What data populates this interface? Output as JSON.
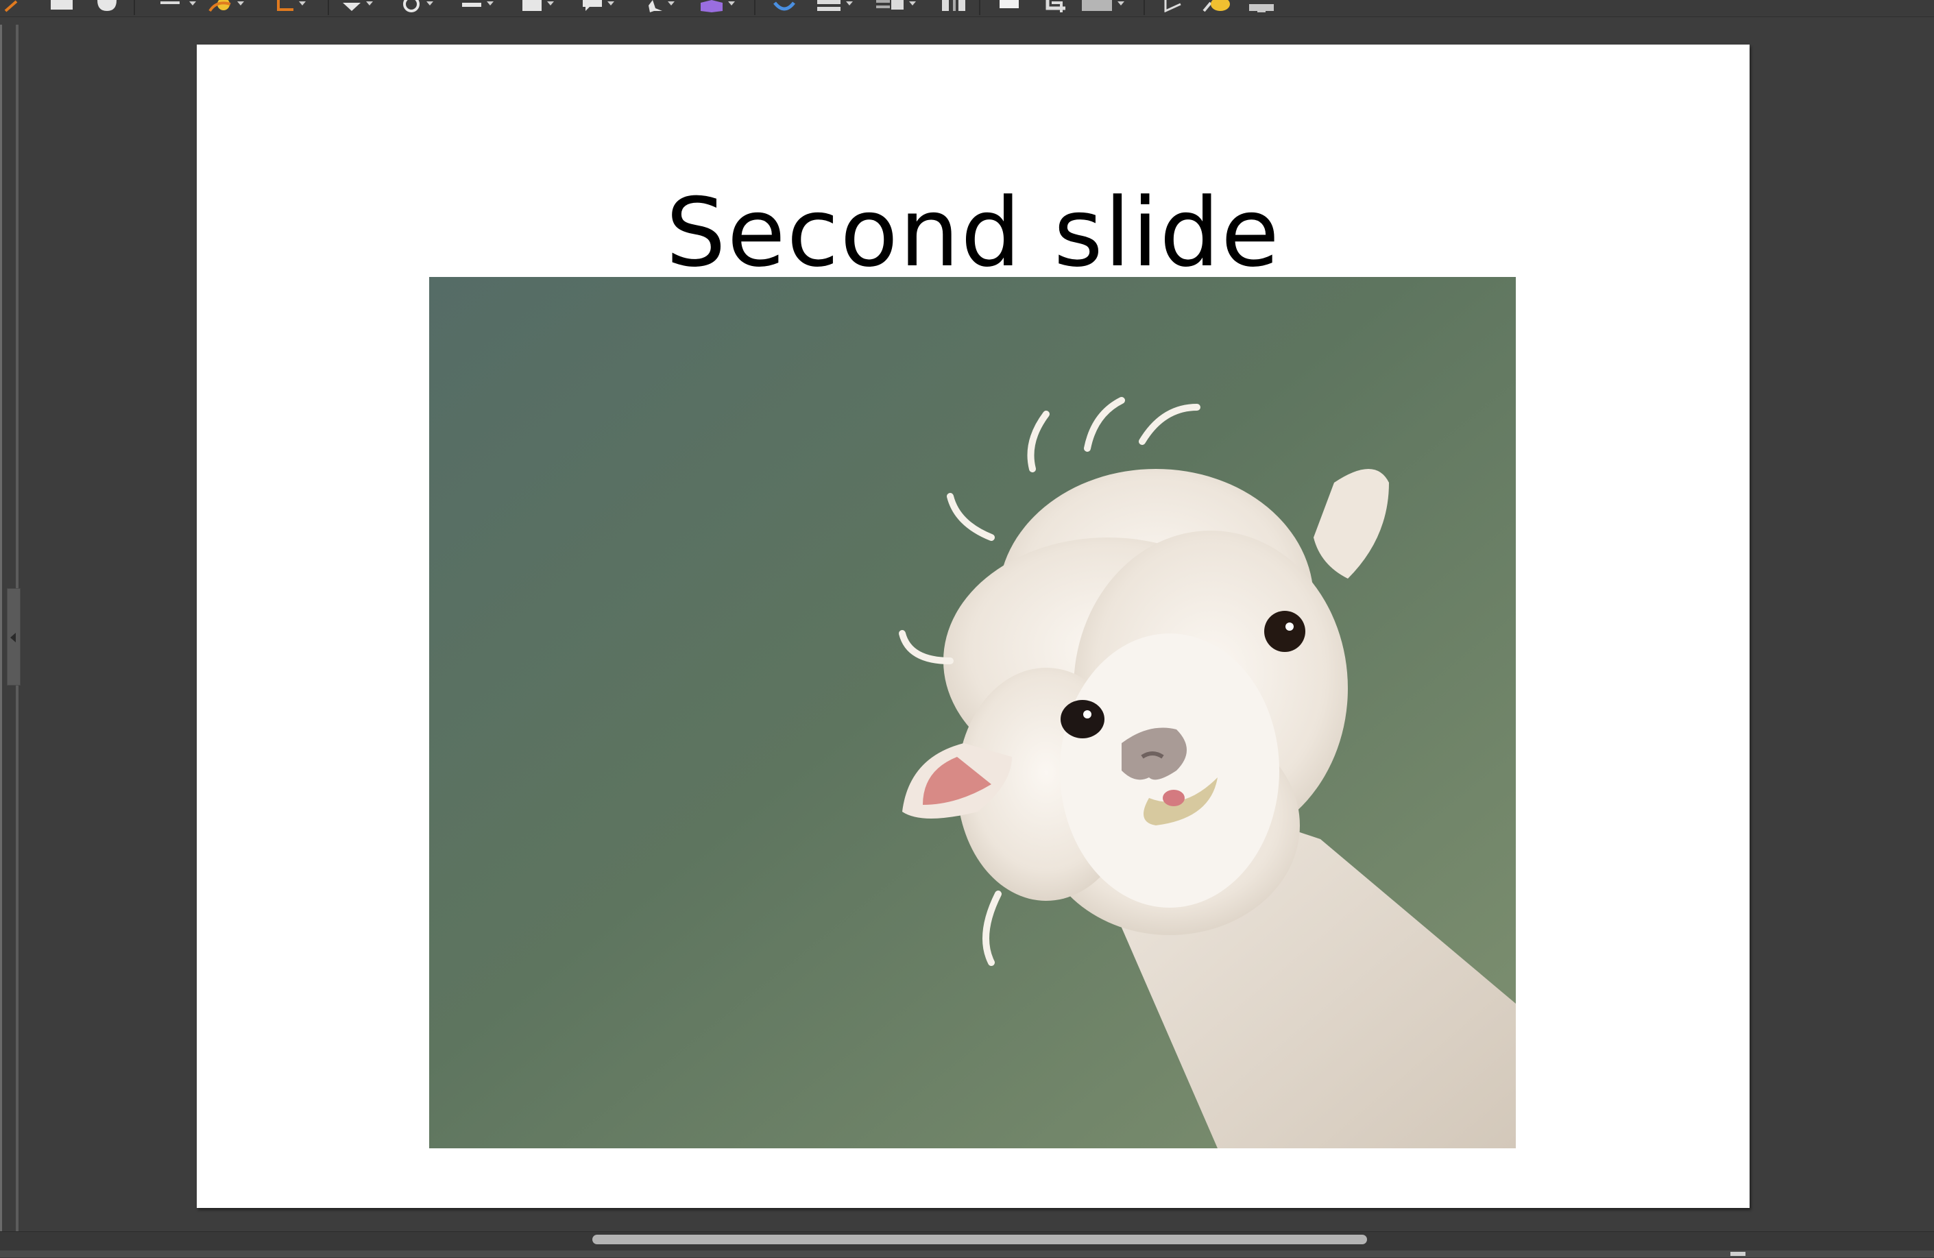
{
  "slide": {
    "title": "Second slide",
    "image_subject": "alpaca",
    "image_background": "#5f7761",
    "fleece_color": "#efe8e0"
  },
  "toolbar": {
    "icons": [
      "draw-line-icon",
      "document-icon",
      "hand-icon",
      "line-arrow-icon",
      "curve-icon",
      "connector-icon",
      "basic-shapes-icon",
      "symbol-shapes-icon",
      "block-arrows-icon",
      "flowchart-icon",
      "callouts-icon",
      "stars-icon",
      "3d-objects-icon",
      "rotate-icon",
      "align-icon",
      "arrange-icon",
      "distribute-icon",
      "shadow-icon",
      "crop-icon",
      "filter-icon",
      "points-icon",
      "glue-points-icon",
      "toggle-extrusion-icon"
    ]
  },
  "colors": {
    "toolbar_bg": "#3b3b3b",
    "workspace_bg": "#3d3d3d",
    "slide_bg": "#ffffff",
    "accent_orange": "#e07a1f",
    "accent_purple": "#9a6ee0",
    "accent_blue": "#4a8fe0",
    "accent_yellow": "#f0c030"
  }
}
